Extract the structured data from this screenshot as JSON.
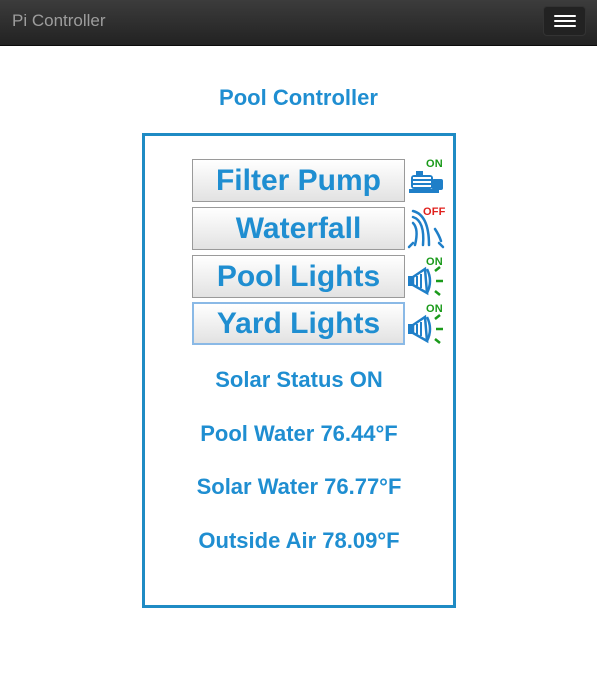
{
  "navbar": {
    "brand": "Pi Controller",
    "menu_icon": "hamburger-menu-icon"
  },
  "page": {
    "title": "Pool Controller"
  },
  "controls": [
    {
      "label": "Filter Pump",
      "state": "ON",
      "state_color": "#1a9a1a",
      "icon": "pump-icon"
    },
    {
      "label": "Waterfall",
      "state": "OFF",
      "state_color": "#e0201c",
      "icon": "waterfall-icon"
    },
    {
      "label": "Pool Lights",
      "state": "ON",
      "state_color": "#1a9a1a",
      "icon": "spotlight-icon"
    },
    {
      "label": "Yard Lights",
      "state": "ON",
      "state_color": "#1a9a1a",
      "icon": "spotlight-icon"
    }
  ],
  "status": {
    "solar": "Solar Status ON",
    "pool_water": "Pool Water 76.44°F",
    "solar_water": "Solar Water 76.77°F",
    "outside_air": "Outside Air 78.09°F"
  },
  "colors": {
    "accent": "#1f8ed1",
    "panel_border": "#1f8bc4",
    "on": "#1a9a1a",
    "off": "#e0201c"
  }
}
